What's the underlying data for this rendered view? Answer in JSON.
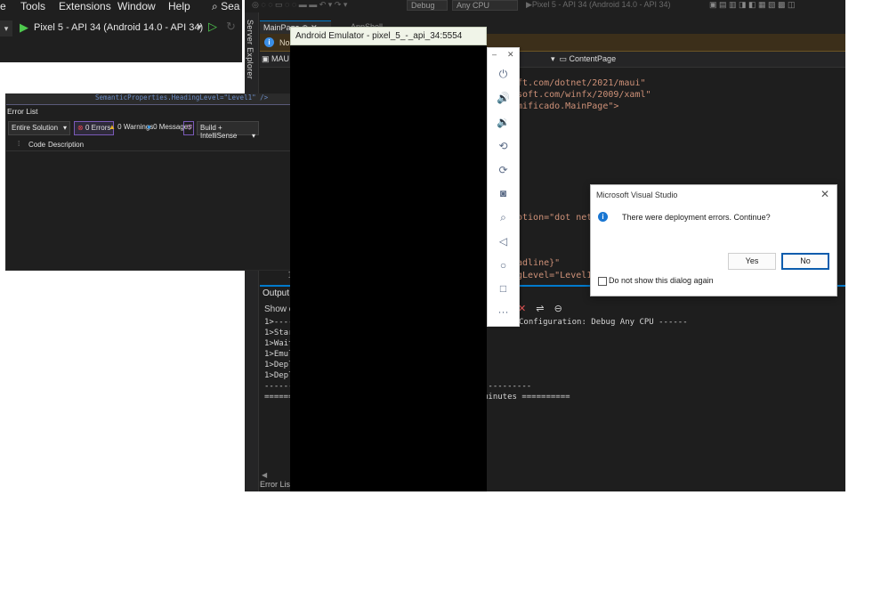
{
  "left_window": {
    "menu": [
      "e",
      "Tools",
      "Extensions",
      "Window",
      "Help"
    ],
    "search_label": "Sea",
    "run_target": "Pixel 5 - API 34 (Android 14.0 - API 34)"
  },
  "main_window": {
    "top_strip": {
      "config": "Debug",
      "platform": "Any CPU",
      "target": "Pixel 5 - API 34 (Android 14.0 - API 34)"
    },
    "server_explorer": "Server Explorer",
    "tabs": [
      "MainPage",
      "AppShell"
    ],
    "info_bar_text": "No",
    "nav_bar": {
      "left": "MAU",
      "right": "ContentPage"
    },
    "code_lines": [
      {
        "text": "ft.com/dotnet/2021/maui\""
      },
      {
        "text": "soft.com/winfx/2009/xaml\""
      },
      {
        "text": "mificado.MainPage\">"
      },
      {
        "text": "otion=\"dot net b"
      },
      {
        "text": "adline}\""
      },
      {
        "text": "gLevel=\"Level1\""
      }
    ],
    "line_number": "1"
  },
  "output": {
    "title": "Output",
    "show_from": "Show o",
    "lines": [
      "1>----",
      "1>Star",
      "1>Wait",
      "1>Emul",
      "1>Depl",
      "1>Depl",
      "-------",
      "======="
    ],
    "right_lines": [
      "Configuration: Debug Any CPU ------",
      "",
      "",
      "",
      "",
      "",
      "----------",
      "minutes =========="
    ],
    "bottom_tab": "Error List"
  },
  "error_list": {
    "header_snippet": "SemanticProperties.HeadingLevel=\"Level1\" />",
    "title": "Error List",
    "scope": "Entire Solution",
    "errors": "0 Errors",
    "warnings": "0 Warnings",
    "messages": "0 Messages",
    "build_filter": "Build + IntelliSense",
    "columns": [
      "Code",
      "Description"
    ]
  },
  "emulator": {
    "title": "Android Emulator - pixel_5_-_api_34:5554",
    "controls": [
      "minimize-icon",
      "close-icon",
      "power-icon",
      "volume-up-icon",
      "volume-down-icon",
      "rotate-left-icon",
      "rotate-right-icon",
      "camera-icon",
      "zoom-icon",
      "back-icon",
      "home-icon",
      "overview-icon",
      "more-icon"
    ]
  },
  "dialog": {
    "title": "Microsoft Visual Studio",
    "message": "There were deployment errors. Continue?",
    "yes": "Yes",
    "no": "No",
    "checkbox_label": "Do not show this dialog again"
  }
}
